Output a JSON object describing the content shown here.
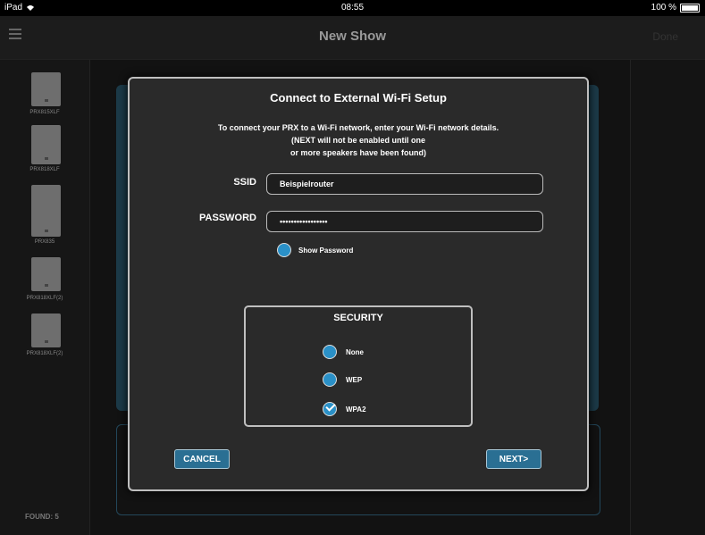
{
  "status_bar": {
    "device": "iPad",
    "wifi_icon": "wifi-icon",
    "time": "08:55",
    "battery": "100 %",
    "battery_icon": "battery-icon"
  },
  "nav": {
    "title": "New Show",
    "done": "Done",
    "menu_icon": "hamburger-menu-icon"
  },
  "sidebar": {
    "speakers": [
      {
        "label": "PRX815XLF"
      },
      {
        "label": "PRX818XLF"
      },
      {
        "label": "PRX835"
      },
      {
        "label": "PRX818XLF(2)"
      },
      {
        "label": "PRX818XLF(2)"
      }
    ],
    "found": "FOUND: 5"
  },
  "dialog": {
    "title": "Connect to External Wi-Fi Setup",
    "description": [
      "To connect your PRX to a Wi-Fi network, enter your Wi-Fi network details.",
      "(NEXT will not be enabled until one",
      "or more speakers have been found)"
    ],
    "ssid_label": "SSID",
    "ssid_value": "Beispielrouter",
    "password_label": "PASSWORD",
    "password_value": "•••••••••••••••••",
    "show_password": "Show Password",
    "security": {
      "title": "SECURITY",
      "options": [
        {
          "label": "None",
          "selected": false
        },
        {
          "label": "WEP",
          "selected": false
        },
        {
          "label": "WPA2",
          "selected": true
        }
      ]
    },
    "cancel": "CANCEL",
    "next": "NEXT>"
  },
  "colors": {
    "accent": "#2a90c7",
    "button": "#2a6f93",
    "stage": "#1c3a48"
  }
}
